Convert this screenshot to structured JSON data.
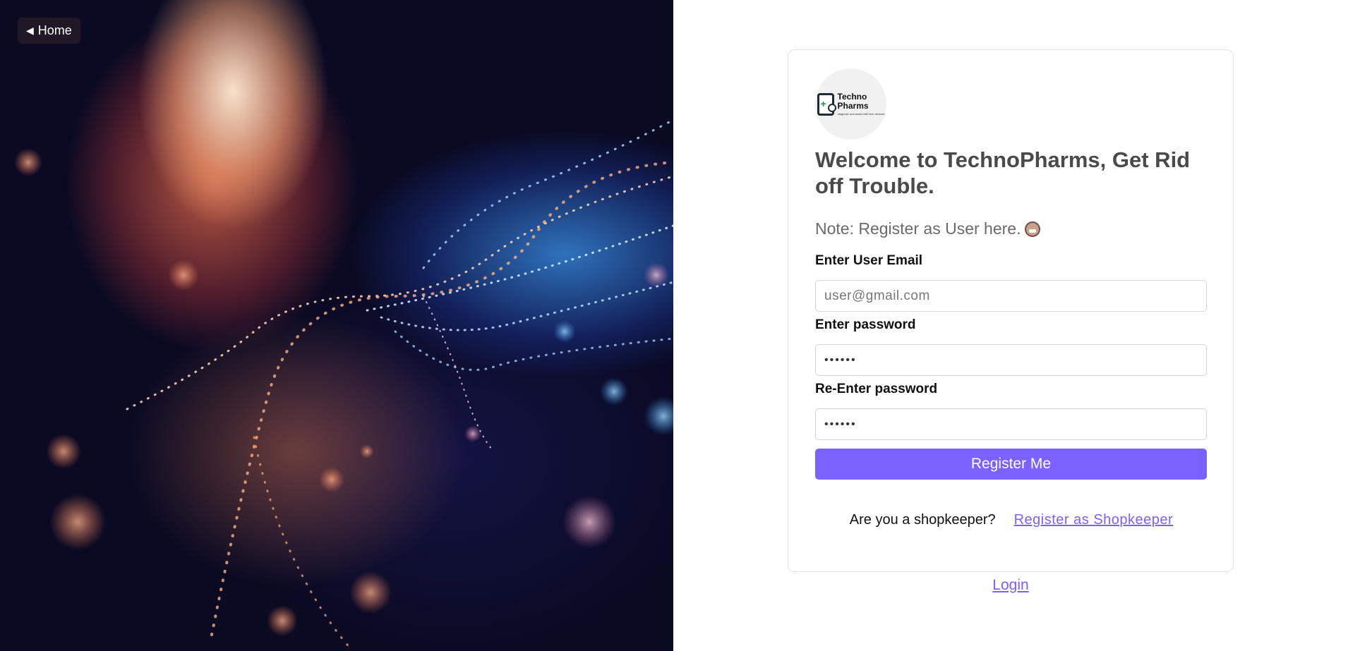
{
  "nav": {
    "home_label": "Home"
  },
  "logo": {
    "name_line1": "Techno",
    "name_line2": "Pharms",
    "tagline": "diagnose and assist with tech devices"
  },
  "form": {
    "heading": "Welcome to TechnoPharms, Get Rid off Trouble.",
    "note": "Note: Register as User here.",
    "email_label": "Enter User Email",
    "email_placeholder": "user@gmail.com",
    "password_label": "Enter password",
    "password_value": "••••••",
    "repassword_label": "Re-Enter password",
    "repassword_value": "••••••",
    "submit_label": "Register Me",
    "shopkeeper_question": "Are you a shopkeeper?",
    "shopkeeper_link": "Register as Shopkeeper",
    "login_link": "Login"
  },
  "colors": {
    "accent": "#7b61ff",
    "heading": "#4a4a4a",
    "note": "#6a6a6a"
  },
  "icons": {
    "home": "triangle-left-icon",
    "note_emoji": "grimacing-face-icon"
  }
}
